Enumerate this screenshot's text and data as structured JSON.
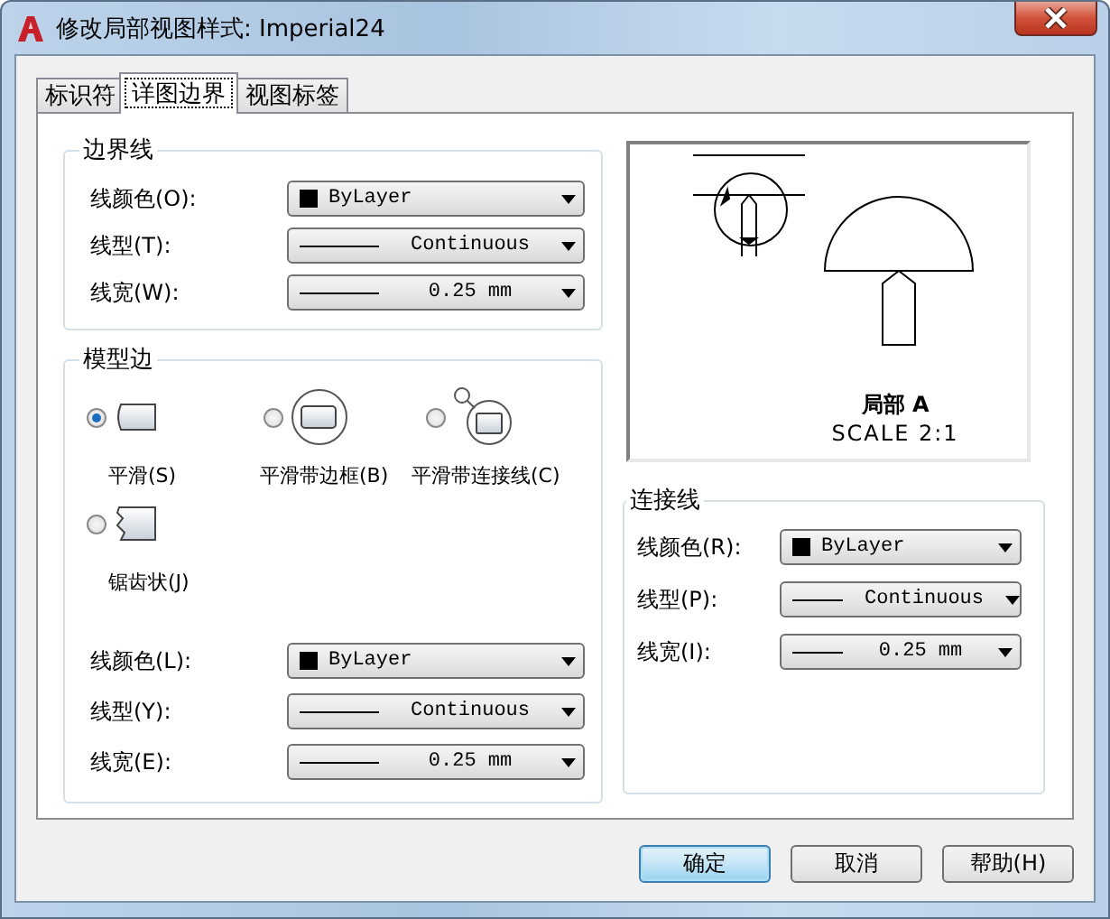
{
  "window": {
    "title": "修改局部视图样式: Imperial24"
  },
  "tabs": [
    {
      "label": "标识符",
      "selected": false
    },
    {
      "label": "详图边界",
      "selected": true
    },
    {
      "label": "视图标签",
      "selected": false
    }
  ],
  "boundary": {
    "title": "边界线",
    "fields": [
      {
        "label": "线颜色(O):",
        "kind": "color",
        "value": "ByLayer"
      },
      {
        "label": "线型(T):",
        "kind": "linetype",
        "value": "Continuous"
      },
      {
        "label": "线宽(W):",
        "kind": "lineweight",
        "value": "0.25 mm"
      }
    ]
  },
  "model_edge": {
    "title": "模型边",
    "options": [
      {
        "label": "平滑(S)",
        "kind": "smooth",
        "selected": true
      },
      {
        "label": "平滑带边框(B)",
        "kind": "border",
        "selected": false
      },
      {
        "label": "平滑带连接线(C)",
        "kind": "connector",
        "selected": false
      },
      {
        "label": "锯齿状(J)",
        "kind": "jagged",
        "selected": false
      }
    ],
    "fields": [
      {
        "label": "线颜色(L):",
        "kind": "color",
        "value": "ByLayer"
      },
      {
        "label": "线型(Y):",
        "kind": "linetype",
        "value": "Continuous"
      },
      {
        "label": "线宽(E):",
        "kind": "lineweight",
        "value": "0.25 mm"
      }
    ]
  },
  "preview": {
    "title": "局部 A",
    "scale": "SCALE 2:1"
  },
  "connector": {
    "title": "连接线",
    "fields": [
      {
        "label": "线颜色(R):",
        "kind": "color",
        "value": "ByLayer"
      },
      {
        "label": "线型(P):",
        "kind": "linetype",
        "value": "Continuous"
      },
      {
        "label": "线宽(I):",
        "kind": "lineweight",
        "value": "0.25 mm"
      }
    ]
  },
  "buttons": [
    {
      "label": "确定",
      "default": true
    },
    {
      "label": "取消",
      "default": false
    },
    {
      "label": "帮助(H)",
      "default": false
    }
  ]
}
